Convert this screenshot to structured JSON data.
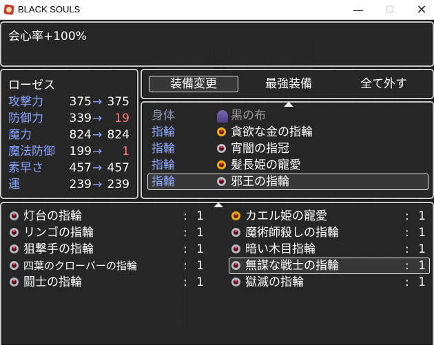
{
  "window": {
    "title": "BLACK SOULS",
    "min_glyph": "—",
    "max_glyph": "☐",
    "close_glyph": "✕"
  },
  "help": {
    "text": "会心率+100%"
  },
  "status": {
    "actor": "ローゼス",
    "arrow": "→",
    "stats": [
      {
        "label": "攻撃力",
        "current": "375",
        "new": "375",
        "change": "same"
      },
      {
        "label": "防御力",
        "current": "339",
        "new": "19",
        "change": "down"
      },
      {
        "label": "魔力",
        "current": "824",
        "new": "824",
        "change": "same"
      },
      {
        "label": "魔法防御",
        "current": "199",
        "new": "1",
        "change": "down"
      },
      {
        "label": "素早さ",
        "current": "457",
        "new": "457",
        "change": "same"
      },
      {
        "label": "運",
        "current": "239",
        "new": "239",
        "change": "same"
      }
    ]
  },
  "command": {
    "equip": "装備変更",
    "optimize": "最強装備",
    "clear": "全て外す"
  },
  "slots": [
    {
      "slot": "身体",
      "item": "黒の布",
      "icon": "robe-icon",
      "disabled": true
    },
    {
      "slot": "指輪",
      "item": "貪欲な金の指輪",
      "icon": "gold-ring-icon",
      "disabled": false
    },
    {
      "slot": "指輪",
      "item": "宵闇の指冠",
      "icon": "silver-ring-icon",
      "disabled": false
    },
    {
      "slot": "指輪",
      "item": "髪長姫の寵愛",
      "icon": "gold-ring-icon",
      "disabled": false
    },
    {
      "slot": "指輪",
      "item": "邪王の指輪",
      "icon": "silver-ring-icon",
      "disabled": false,
      "selected": true
    }
  ],
  "items": {
    "left": [
      {
        "name": "灯台の指輪",
        "count": "1",
        "icon": "silver-ring-icon"
      },
      {
        "name": "リンゴの指輪",
        "count": "1",
        "icon": "silver-ring-icon"
      },
      {
        "name": "狙撃手の指輪",
        "count": "1",
        "icon": "silver-ring-icon"
      },
      {
        "name": "四葉のクローバーの指輪",
        "count": "1",
        "icon": "silver-ring-icon"
      },
      {
        "name": "闘士の指輪",
        "count": "1",
        "icon": "silver-ring-icon"
      }
    ],
    "right": [
      {
        "name": "カエル姫の寵愛",
        "count": "1",
        "icon": "gold-ring-icon"
      },
      {
        "name": "魔術師殺しの指輪",
        "count": "1",
        "icon": "silver-ring-icon"
      },
      {
        "name": "暗い木目指輪",
        "count": "1",
        "icon": "silver-ring-icon"
      },
      {
        "name": "無謀な戦士の指輪",
        "count": "1",
        "icon": "silver-ring-icon",
        "selected": true
      },
      {
        "name": "獄滅の指輪",
        "count": "1",
        "icon": "silver-ring-icon"
      }
    ],
    "separator": ":"
  },
  "colors": {
    "system": "#8aa4ff",
    "down": "#ff7a7a",
    "disabled": "#9a9a9a"
  }
}
